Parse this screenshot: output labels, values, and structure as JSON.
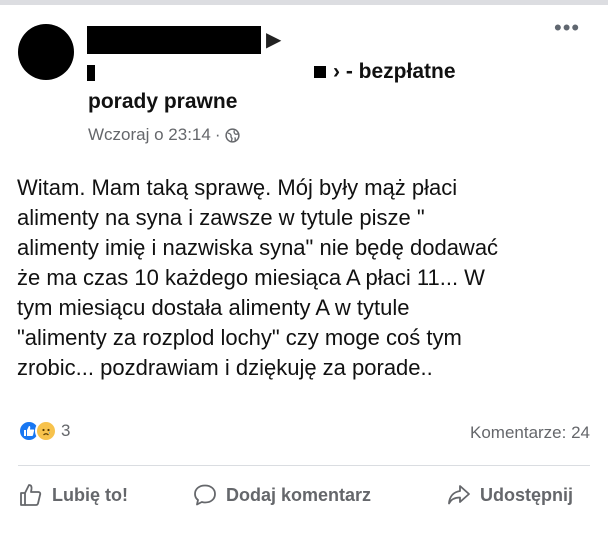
{
  "post": {
    "group_name_line1": "› - bezpłatne",
    "group_name_line2": "porady prawne",
    "timestamp": "Wczoraj o 23:14",
    "separator": "·",
    "privacy_icon": "globe-icon",
    "more_icon": "•••",
    "body_lines": [
      "Witam. Mam taką sprawę. Mój były mąż płaci",
      "alimenty  na syna i zawsze w tytule pisze \"",
      "alimenty imię i nazwiska syna\" nie będę dodawać",
      "że ma czas 10 każdego miesiąca A płaci 11... W",
      "tym miesiącu dostała alimenty A w tytule",
      "\"alimenty za rozplod lochy\" czy moge coś tym",
      "zrobic... pozdrawiam i dziękuję za porade.."
    ],
    "reactions": {
      "types": [
        "like",
        "sad"
      ],
      "count": "3"
    },
    "comments": "Komentarze: 24"
  },
  "actions": {
    "like": "Lubię to!",
    "comment": "Dodaj komentarz",
    "share": "Udostępnij"
  },
  "colors": {
    "like_blue": "#1877f2",
    "sad_yellow": "#f7c24c",
    "meta_gray": "#65676b"
  }
}
